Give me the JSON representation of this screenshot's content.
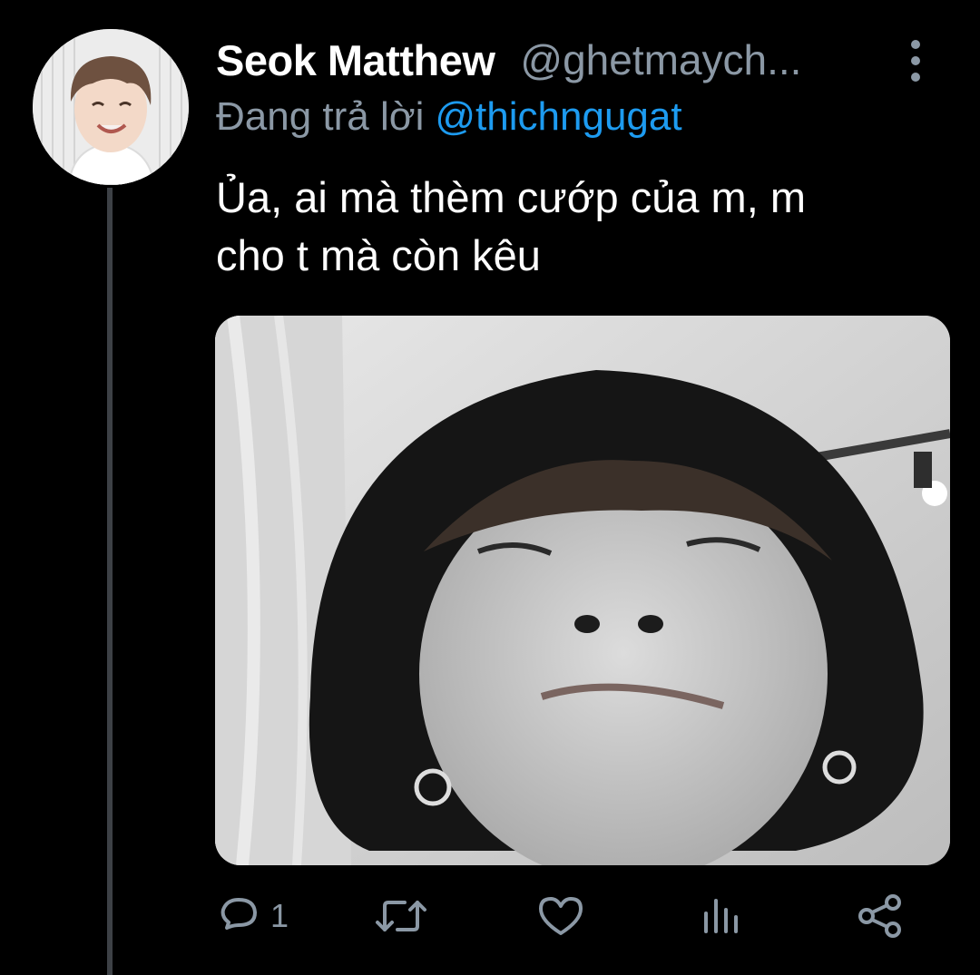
{
  "tweet": {
    "display_name": "Seok Matthew",
    "handle": "@ghetmaych...",
    "reply_prefix": "Đang trả lời",
    "reply_to": "@thichngugat",
    "text_lines": [
      "Ủa, ai mà thèm cướp của m, m",
      "cho t mà còn kêu"
    ],
    "reply_count": "1"
  },
  "icons": {
    "more": "vertical-dots-icon",
    "reply": "speech-bubble-icon",
    "retweet": "retweet-icon",
    "like": "heart-icon",
    "analytics": "bar-chart-icon",
    "share": "share-icon"
  },
  "colors": {
    "background": "#000000",
    "text": "#ffffff",
    "secondary": "#8b98a5",
    "link": "#1d9bf0",
    "thread_line": "#3d4146"
  }
}
